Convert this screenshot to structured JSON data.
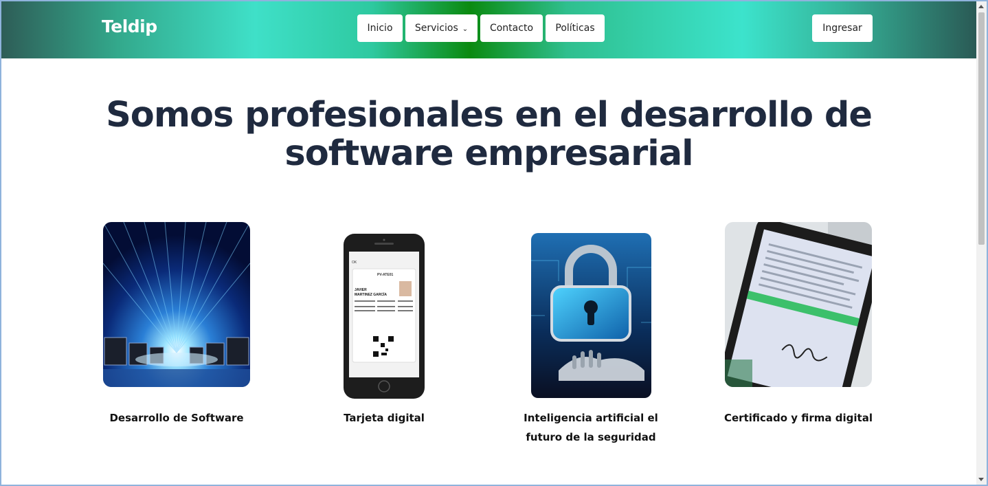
{
  "navbar": {
    "brand": "Teldip",
    "items": [
      {
        "label": "Inicio"
      },
      {
        "label": "Servicios",
        "icon": "chevron-down-icon"
      },
      {
        "label": "Contacto"
      },
      {
        "label": "Políticas"
      }
    ],
    "login_label": "Ingresar"
  },
  "hero": {
    "line1": "Somos profesionales en el desarrollo de",
    "line2": "software empresarial"
  },
  "cards": [
    {
      "title": "Desarrollo de Software"
    },
    {
      "title": "Tarjeta digital",
      "card": {
        "header_right": "PV-ATE01",
        "name_line1": "JAVIER",
        "name_line2": "MARTINEZ GARCÍA",
        "back": "OK"
      }
    },
    {
      "title_line1": "Inteligencia artificial el",
      "title_line2": "futuro de la seguridad"
    },
    {
      "title": "Certificado y firma digital"
    }
  ],
  "colors": {
    "heading": "#1f2a3f",
    "accent": "#3fe0c8",
    "green": "#0b8a10"
  }
}
